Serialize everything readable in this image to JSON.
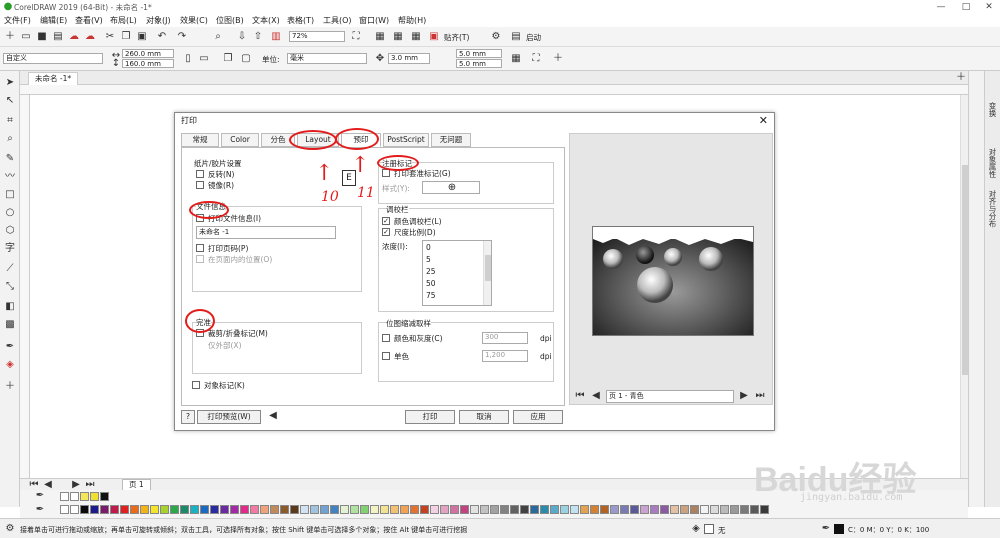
{
  "app": {
    "title": "CorelDRAW 2019 (64-Bit) - 未命名 -1*",
    "minimize": "—",
    "maximize": "□",
    "close": "✕"
  },
  "menu": [
    "文件(F)",
    "编辑(E)",
    "查看(V)",
    "布局(L)",
    "对象(J)",
    "效果(C)",
    "位图(B)",
    "文本(X)",
    "表格(T)",
    "工具(O)",
    "窗口(W)",
    "帮助(H)"
  ],
  "toolbar": {
    "zoom": "72%",
    "snap": "贴齐(T)",
    "launch": "启动"
  },
  "propbar": {
    "preset": "自定义",
    "width": "260.0 mm",
    "height": "160.0 mm",
    "units_label": "单位:",
    "units": "毫米",
    "nudge": "3.0 mm",
    "dup_x": "5.0 mm",
    "dup_y": "5.0 mm"
  },
  "doc_tab": "未命名 -1*",
  "right_tabs": [
    "变换",
    "对象属性",
    "对齐与分布"
  ],
  "page_tab": "页 1",
  "status": {
    "hint": "接着单击可进行拖动或缩放；再单击可旋转或倾斜；双击工具，可选择所有对象；按住 Shift 键单击可选择多个对象；按住 Alt 键单击可进行挖掘",
    "fill": "无",
    "cmyk": "C：0 M：0 Y：0 K：100"
  },
  "dialog": {
    "title": "打印",
    "close": "✕",
    "tabs": [
      "常规",
      "Color",
      "分色",
      "Layout",
      "预印",
      "PostScript",
      "无问题"
    ],
    "paper_group": "纸片/胶片设置",
    "invert": "反转(N)",
    "mirror": "镜像(R)",
    "file_info_group": "文件信息",
    "print_file_info": "打印文件信息(I)",
    "file_info_value": "未命名 -1",
    "print_page_numbers": "打印页码(P)",
    "inside_page": "在页面内的位置(O)",
    "crop_group": "完准",
    "crop_marks": "裁剪/折叠标记(M)",
    "exterior_only": "仅外部(X)",
    "object_marks": "对象标记(K)",
    "reg_group": "注册标记",
    "print_reg_marks": "打印套准标记(G)",
    "style_label": "样式(Y):",
    "calib_group": "调校栏",
    "color_calib": "颜色调校栏(L)",
    "densitometer": "尺度比例(D)",
    "density_label": "浓度(I):",
    "density_values": [
      "0",
      "5",
      "25",
      "50",
      "75"
    ],
    "reduce_group": "位图缩减取样",
    "color_gray": "颜色和灰度(C)",
    "color_gray_val": "300",
    "mono": "单色",
    "mono_val": "1,200",
    "dpi": "dpi",
    "help_btn": "?",
    "print_preview": "打印预览(W)",
    "print": "打印",
    "cancel": "取消",
    "apply": "应用",
    "page_select": "页 1 - 青色",
    "annot_10": "10",
    "annot_11": "11"
  },
  "watermark": "Baidu经验",
  "watermark_url": "jingyan.baidu.com"
}
